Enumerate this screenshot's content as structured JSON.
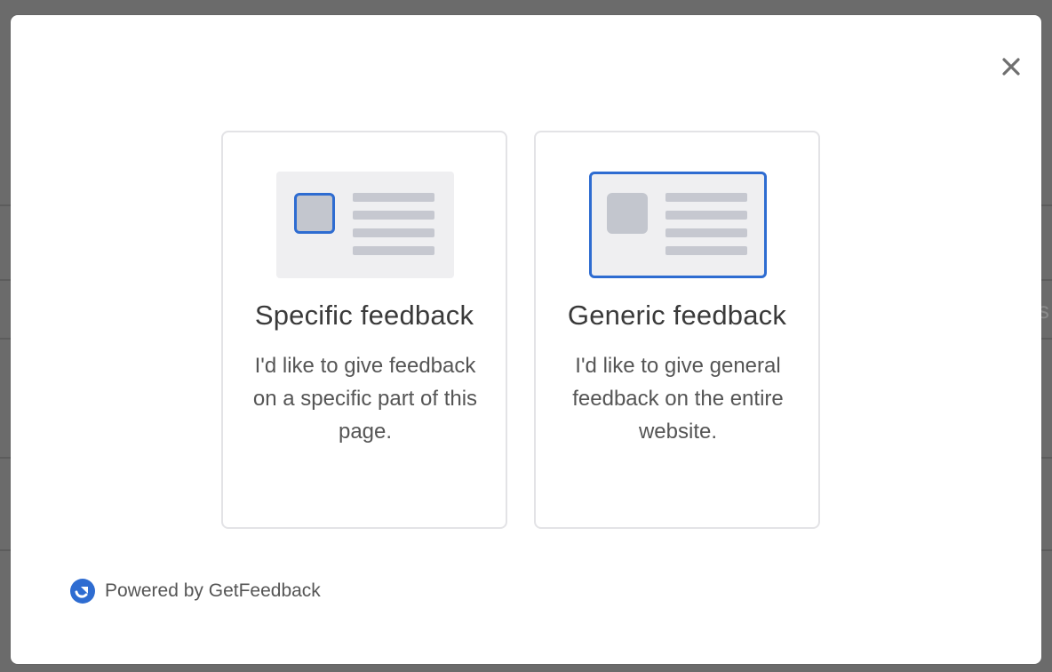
{
  "close": {
    "icon": "close-icon"
  },
  "options": [
    {
      "title": "Specific feedback",
      "description": "I'd like to give feedback on a specific part of this page.",
      "icon": "specific-area-illustration"
    },
    {
      "title": "Generic feedback",
      "description": "I'd like to give general feedback on the entire website.",
      "icon": "whole-page-illustration"
    }
  ],
  "footer": {
    "text": "Powered by GetFeedback",
    "icon": "getfeedback-logo-icon"
  },
  "background": {
    "edge_text": "s"
  },
  "colors": {
    "accent": "#2e6cd1",
    "overlay": "#6b6b6b",
    "card_border": "#e3e3e6",
    "placeholder": "#c6c8d0"
  }
}
